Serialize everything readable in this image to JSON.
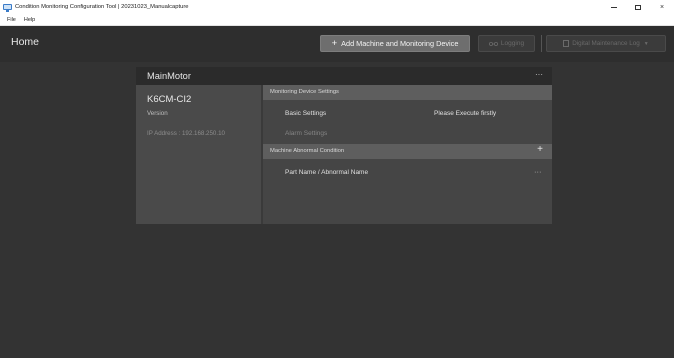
{
  "window": {
    "title": "Condition Monitoring Configuration Tool  |  20231023_Manualcapture",
    "minimize": "",
    "maximize": "",
    "close": "×"
  },
  "menu": {
    "items": [
      "File",
      "Help"
    ]
  },
  "header": {
    "title": "Home",
    "add_button": "Add Machine and Monitoring Device",
    "add_plus": "+",
    "logging_button": "Logging",
    "dml_button": "Digital Maintenance Log",
    "dml_caret": "▼"
  },
  "card": {
    "title": "MainMotor",
    "menu": "···",
    "model": "K6CM-CI2",
    "version_label": "Version",
    "ip_address": "IP Address  :  192.168.250.10",
    "monitoring_section": "Monitoring Device Settings",
    "basic_settings": "Basic Settings",
    "basic_status": "Please Execute firstly",
    "alarm_settings": "Alarm Settings",
    "abnormal_section": "Machine Abnormal Condition",
    "abnormal_add": "+",
    "part_name": "Part Name / Abnormal Name",
    "part_menu": "···"
  },
  "colors": {
    "accent_button": "#6e6e6e",
    "background": "#333333",
    "card_header": "#2b2b2b",
    "section_header": "#5e5e5e"
  }
}
